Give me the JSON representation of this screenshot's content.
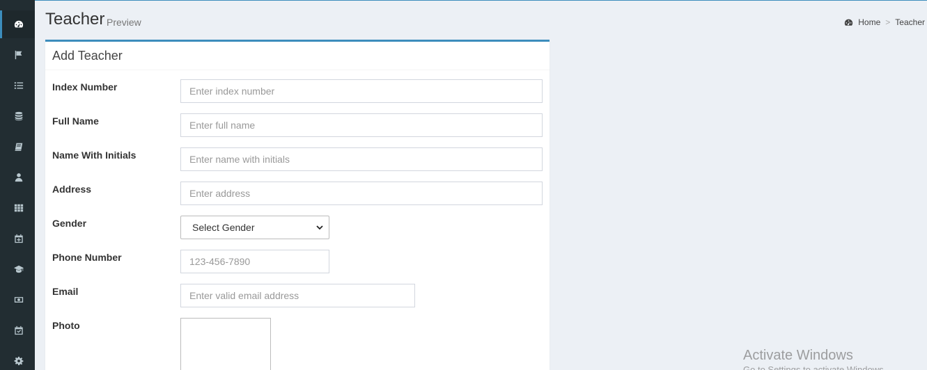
{
  "header": {
    "title": "Teacher",
    "subtitle": "Preview"
  },
  "breadcrumb": {
    "icon": "dashboard-icon",
    "home": "Home",
    "separator": ">",
    "current": "Teacher"
  },
  "sidebar": {
    "items": [
      {
        "icon": "dashboard-icon",
        "active": true
      },
      {
        "icon": "flag-icon"
      },
      {
        "icon": "list-icon"
      },
      {
        "icon": "database-icon"
      },
      {
        "icon": "book-icon"
      },
      {
        "icon": "user-icon"
      },
      {
        "icon": "grid-icon"
      },
      {
        "icon": "calendar-plus-icon"
      },
      {
        "icon": "graduation-cap-icon"
      },
      {
        "icon": "money-icon"
      },
      {
        "icon": "calendar-check-icon"
      },
      {
        "icon": "gear-icon"
      }
    ]
  },
  "form": {
    "title": "Add Teacher",
    "fields": {
      "index_number": {
        "label": "Index Number",
        "placeholder": "Enter index number"
      },
      "full_name": {
        "label": "Full Name",
        "placeholder": "Enter full name"
      },
      "name_with_initials": {
        "label": "Name With Initials",
        "placeholder": "Enter name with initials"
      },
      "address": {
        "label": "Address",
        "placeholder": "Enter address"
      },
      "gender": {
        "label": "Gender",
        "selected": "Select Gender"
      },
      "phone": {
        "label": "Phone Number",
        "placeholder": "123-456-7890"
      },
      "email": {
        "label": "Email",
        "placeholder": "Enter valid email address"
      },
      "photo": {
        "label": "Photo"
      }
    }
  },
  "watermark": {
    "title": "Activate Windows",
    "subtitle": "Go to Settings to activate Windows."
  },
  "colors": {
    "sidebar_bg": "#222d32",
    "accent": "#3c8dbc",
    "content_bg": "#ecf0f5"
  }
}
